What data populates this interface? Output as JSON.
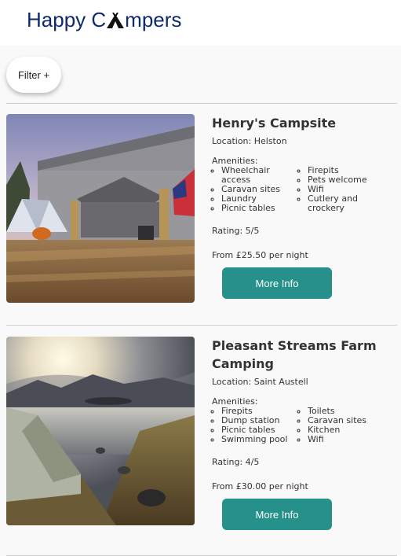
{
  "header": {
    "brand_part1": "Happy C",
    "brand_part2": "mpers",
    "brand_icon": "tent-icon",
    "brand_color": "#0f2a6b"
  },
  "filter": {
    "label": "Filter +"
  },
  "campsites": [
    {
      "name": "Henry's Campsite",
      "location": "Location: Helston",
      "amenities_label": "Amenities:",
      "amenities_col1": [
        "Wheelchair access",
        "Caravan sites",
        "Laundry",
        "Picnic tables"
      ],
      "amenities_col2": [
        "Firepits",
        "Pets welcome",
        "Wifi",
        "Cutlery and crockery"
      ],
      "rating": "Rating: 5/5",
      "price": "From £25.50 per night",
      "button": "More Info"
    },
    {
      "name": "Pleasant Streams Farm Camping",
      "location": "Location: Saint Austell",
      "amenities_label": "Amenities:",
      "amenities_col1": [
        "Firepits",
        "Dump station",
        "Picnic tables",
        "Swimming pool"
      ],
      "amenities_col2": [
        "Toilets",
        "Caravan sites",
        "Kitchen",
        "Wifi"
      ],
      "rating": "Rating: 4/5",
      "price": "From £30.00 per night",
      "button": "More Info"
    }
  ],
  "colors": {
    "button": "#26918a",
    "background": "#f9f9f9"
  }
}
